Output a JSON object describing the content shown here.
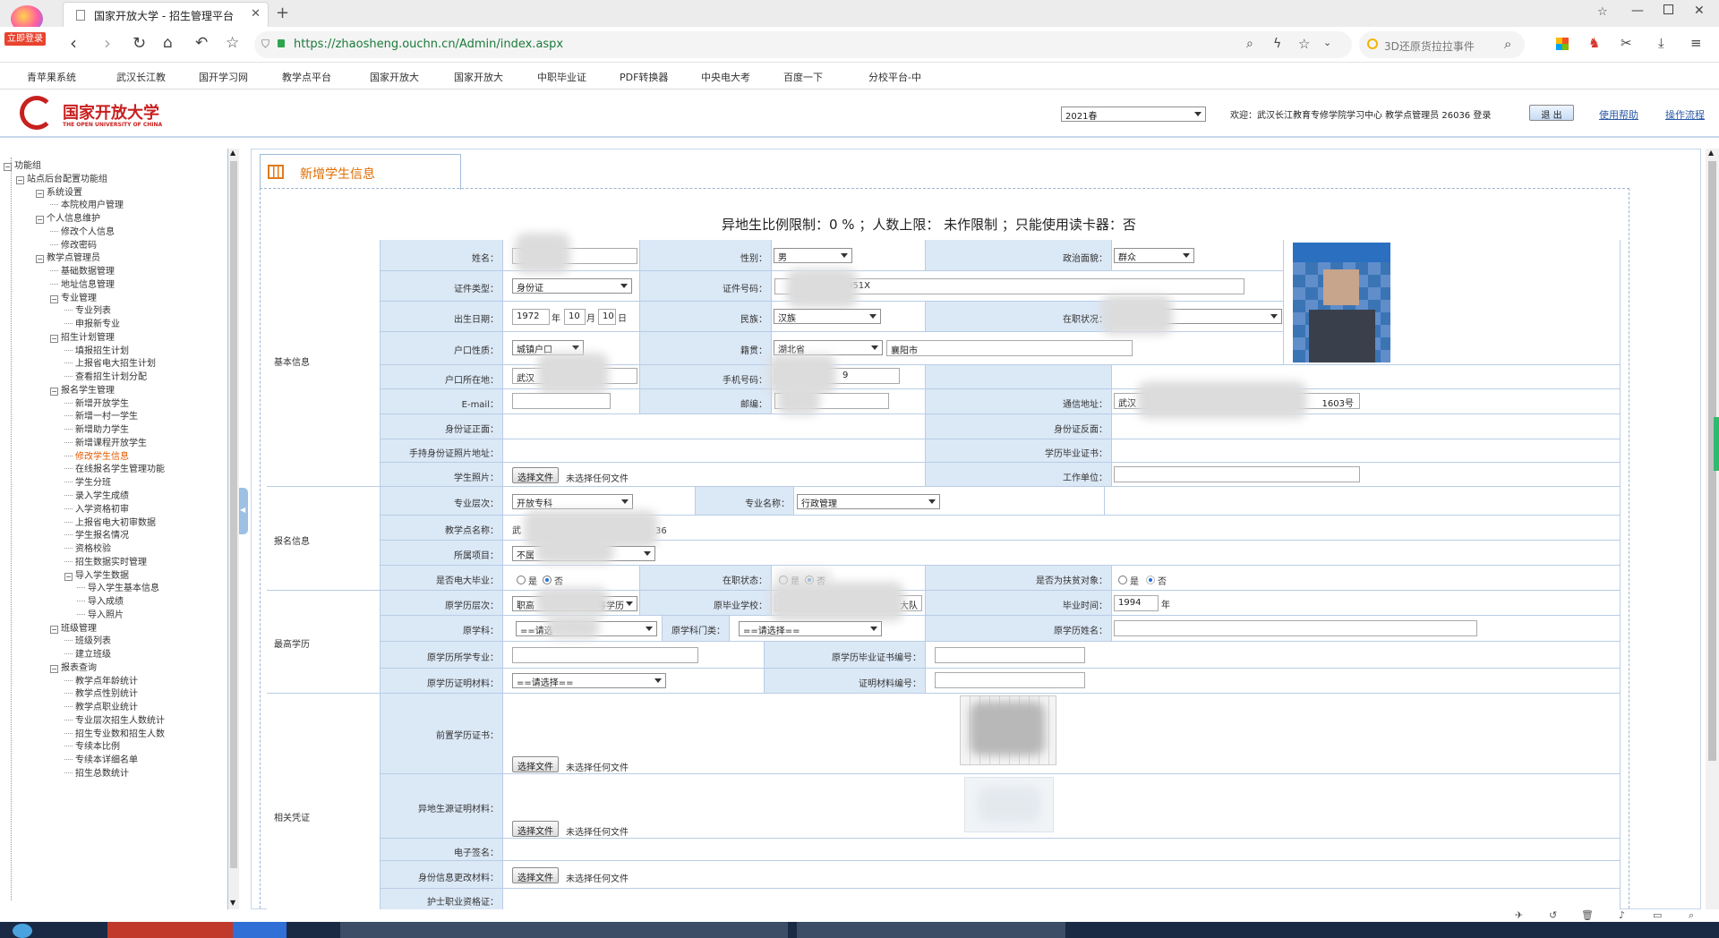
{
  "browser": {
    "login_badge": "立即登录",
    "tab_title": "国家开放大学 - 招生管理平台",
    "url": "https://zhaosheng.ouchn.cn/Admin/index.aspx",
    "search_text": "3D还原货拉拉事件",
    "bookmarks": [
      "青苹果系统",
      "武汉长江教",
      "国开学习网",
      "教学点平台",
      "国家开放大",
      "国家开放大",
      "中职毕业证",
      "PDF转换器",
      "中央电大考",
      "百度一下",
      "分校平台-中"
    ]
  },
  "header": {
    "logo_cn": "国家开放大学",
    "logo_en": "THE OPEN UNIVERSITY OF CHINA",
    "term_select": "2021春",
    "welcome": "欢迎：武汉长江教育专修学院学习中心 教学点管理员 26036 登录",
    "logout_label": "退 出",
    "help_link": "使用帮助",
    "flow_link": "操作流程"
  },
  "sidebar": {
    "items": [
      {
        "label": "功能组",
        "level": 0
      },
      {
        "label": "站点后台配置功能组",
        "level": 1
      },
      {
        "label": "系统设置",
        "level": 2
      },
      {
        "label": "本院校用户管理",
        "level": 3
      },
      {
        "label": "个人信息维护",
        "level": 2
      },
      {
        "label": "修改个人信息",
        "level": 3
      },
      {
        "label": "修改密码",
        "level": 3
      },
      {
        "label": "教学点管理员",
        "level": 2
      },
      {
        "label": "基础数据管理",
        "level": 3
      },
      {
        "label": "地址信息管理",
        "level": 3
      },
      {
        "label": "专业管理",
        "level": 3
      },
      {
        "label": "专业列表",
        "level": 4
      },
      {
        "label": "申报新专业",
        "level": 4
      },
      {
        "label": "招生计划管理",
        "level": 3
      },
      {
        "label": "填报招生计划",
        "level": 4
      },
      {
        "label": "上报省电大招生计划",
        "level": 4
      },
      {
        "label": "查看招生计划分配",
        "level": 4
      },
      {
        "label": "报名学生管理",
        "level": 3
      },
      {
        "label": "新增开放学生",
        "level": 4
      },
      {
        "label": "新增一村一学生",
        "level": 4
      },
      {
        "label": "新增助力学生",
        "level": 4
      },
      {
        "label": "新增课程开放学生",
        "level": 4
      },
      {
        "label": "修改学生信息",
        "level": 4,
        "active": true
      },
      {
        "label": "在线报名学生管理功能",
        "level": 4
      },
      {
        "label": "学生分班",
        "level": 4
      },
      {
        "label": "录入学生成绩",
        "level": 4
      },
      {
        "label": "入学资格初审",
        "level": 4
      },
      {
        "label": "上报省电大初审数据",
        "level": 4
      },
      {
        "label": "学生报名情况",
        "level": 4
      },
      {
        "label": "资格校验",
        "level": 4
      },
      {
        "label": "招生数据实时管理",
        "level": 4
      },
      {
        "label": "导入学生数据",
        "level": 4
      },
      {
        "label": "导入学生基本信息",
        "level": 5
      },
      {
        "label": "导入成绩",
        "level": 5
      },
      {
        "label": "导入照片",
        "level": 5
      },
      {
        "label": "班级管理",
        "level": 3
      },
      {
        "label": "班级列表",
        "level": 4
      },
      {
        "label": "建立班级",
        "level": 4
      },
      {
        "label": "报表查询",
        "level": 3
      },
      {
        "label": "教学点年龄统计",
        "level": 4
      },
      {
        "label": "教学点性别统计",
        "level": 4
      },
      {
        "label": "教学点职业统计",
        "level": 4
      },
      {
        "label": "专业层次招生人数统计",
        "level": 4
      },
      {
        "label": "招生专业数和招生人数",
        "level": 4
      },
      {
        "label": "专续本比例",
        "level": 4
      },
      {
        "label": "专续本详细名单",
        "level": 4
      },
      {
        "label": "招生总数统计",
        "level": 4
      }
    ]
  },
  "panel": {
    "title": "新增学生信息",
    "limit_text": "异地生比例限制：0 % ；人数上限： 未作限制 ；只能使用读卡器：否"
  },
  "form": {
    "sections": {
      "basic": "基本信息",
      "enroll": "报名信息",
      "edu": "最高学历",
      "cert": "相关凭证"
    },
    "labels": {
      "name": "姓名：",
      "gender": "性别：",
      "politics": "政治面貌：",
      "id_type": "证件类型：",
      "id_number": "证件号码：",
      "birth": "出生日期：",
      "ethnicity": "民族：",
      "job_status": "在职状况：",
      "hukou_type": "户口性质：",
      "native": "籍贯：",
      "hukou_addr": "户口所在地：",
      "phone": "手机号码：",
      "email": "E-mail：",
      "postcode": "邮编：",
      "address": "通信地址：",
      "id_front": "身份证正面：",
      "id_back": "身份证反面：",
      "id_hand": "手持身份证照片地址：",
      "diploma": "学历毕业证书：",
      "photo": "学生照片：",
      "employer": "工作单位：",
      "level": "专业层次：",
      "major": "专业名称：",
      "site": "教学点名称：",
      "project": "所属项目：",
      "tvu_grad": "是否电大毕业：",
      "in_service": "在职状态：",
      "poverty": "是否为扶贫对象：",
      "orig_level": "原学历层次：",
      "orig_school": "原毕业学校：",
      "grad_time": "毕业时间：",
      "orig_subject": "原学科：",
      "orig_subject_cat": "原学科门类：",
      "orig_name": "原学历姓名：",
      "orig_major": "原学历所学专业：",
      "orig_cert_no": "原学历毕业证书编号：",
      "orig_proof": "原学历证明材料：",
      "proof_no": "证明材料编号：",
      "prev_cert": "前置学历证书：",
      "nonlocal": "异地生源证明材料：",
      "esign": "电子签名：",
      "id_change": "身份信息更改材料：",
      "nurse": "护士职业资格证："
    },
    "values": {
      "gender": "男",
      "politics": "群众",
      "id_type": "身份证",
      "id_number_tail": "951X",
      "birth_year": "1972",
      "birth_month": "10",
      "birth_day": "10",
      "year_unit": "年",
      "month_unit": "月",
      "day_unit": "日",
      "ethnicity": "汉族",
      "hukou_type": "城镇户口",
      "province": "湖北省",
      "city": "襄阳市",
      "hukou_addr_head": "武汉",
      "phone_tail": "9",
      "address_head": "武汉",
      "address_tail": "1603号",
      "level": "开放专科",
      "major": "行政管理",
      "site_head": "武",
      "site_tail": "36",
      "project": "不属",
      "orig_level": "职高",
      "orig_level_tail": "等学历",
      "orig_school_tail": "大队",
      "grad_year": "1994",
      "orig_subject": "==请选",
      "orig_subject_cat": "==请选择==",
      "orig_proof": "==请选择=="
    },
    "radio": {
      "yes": "是",
      "no": "否"
    },
    "file_button": "选择文件",
    "file_none": "未选择任何文件"
  }
}
